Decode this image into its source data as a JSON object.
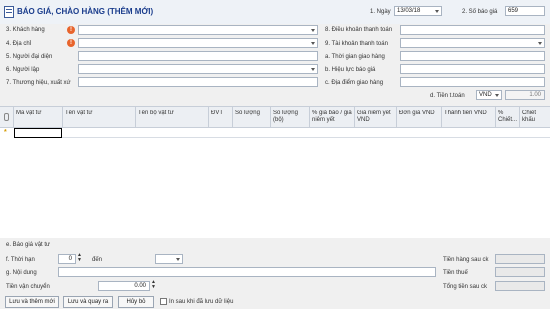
{
  "header": {
    "title": "BÁO GIÁ, CHÀO HÀNG (THÊM MỚI)",
    "date_label": "1. Ngày",
    "date_value": "13/03/18",
    "quote_no_label": "2. Số báo giá",
    "quote_no_value": "659"
  },
  "form": {
    "customer_label": "3. Khách hàng",
    "address_label": "4. Địa chỉ",
    "representative_label": "5. Người đại diện",
    "creator_label": "6. Người lập",
    "brand_label": "7. Thương hiệu, xuất xứ",
    "payment_terms_label": "8. Điều khoản thanh toán",
    "payment_account_label": "9. Tài khoản thanh toán",
    "delivery_time_label": "a. Thời gian giao hàng",
    "validity_label": "b. Hiệu lực báo giá",
    "delivery_place_label": "c. Địa điểm giao hàng",
    "currency_label": "d. Tiền t.toán",
    "currency_value": "VND",
    "rate_value": "1.00"
  },
  "grid": {
    "columns": [
      "Mã vật tư",
      "Tên vật tư",
      "Tên bộ vật tư",
      "ĐVT",
      "Số lượng",
      "Số lượng (bộ)",
      "% giá báo / giá niêm yết",
      "Giá niêm yết VND",
      "Đơn giá VND",
      "Thành tiền VND",
      "% Chiết...",
      "Chiết khấu"
    ],
    "new_row_marker": "*"
  },
  "footer": {
    "section_label": "e. Báo giá vật tư",
    "period_label": "f. Thời hạn",
    "period_value": "0",
    "to_label": "đến",
    "content_label": "g. Nội dung",
    "shipping_label": "Tiền vận chuyển",
    "shipping_value": "0.00",
    "subtotal_label": "Tiền hàng sau ck",
    "tax_label": "Tiền thuế",
    "total_label": "Tổng tiền sau ck"
  },
  "actions": {
    "save_new": "Lưu và thêm mới",
    "save_back": "Lưu và quay ra",
    "cancel": "Hủy bỏ",
    "print_after_save": "In sau khi đã lưu dữ liệu"
  },
  "colors": {
    "accent": "#1a3c8c",
    "warning": "#e8642c",
    "selected_cell": "#000000"
  }
}
